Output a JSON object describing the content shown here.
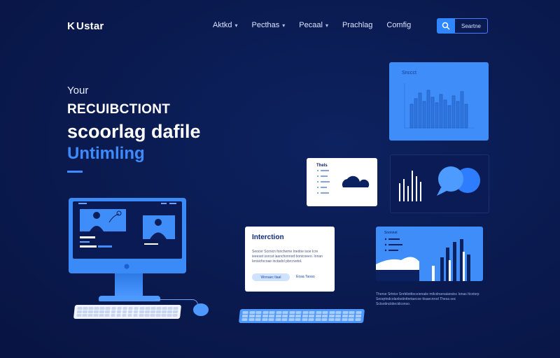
{
  "header": {
    "logo": "Ustar",
    "nav": [
      {
        "label": "Aktkd",
        "has_menu": true
      },
      {
        "label": "Pecthas",
        "has_menu": true
      },
      {
        "label": "Pecaal",
        "has_menu": true
      },
      {
        "label": "Prachlag",
        "has_menu": false
      },
      {
        "label": "Comfig",
        "has_menu": false
      }
    ],
    "search_label": "Seartne"
  },
  "hero": {
    "eyebrow": "Your",
    "line1": "RECUIBCTIONT",
    "line2": "scoorlag dafile",
    "line3": "Untimling"
  },
  "cards": {
    "chart_label": "Snccct",
    "list_title": "Thels",
    "interaction": {
      "title": "Interction",
      "body": "Seocer Scrnicn foncheme Inedoe isoe Icre ieeeset sorcut iaanchonnod bonicoeeo. Ionan Iensicfocoae inctadol pbrcrvetol.",
      "button": "Wnnaec tlaal",
      "link": "Eoaa Taoao"
    },
    "analytics_label": "Snonnet"
  },
  "caption": "Therse Srtnisr Snrbliotttoceienaiie mtlcdrsenaiansisc Ienas Itcotsrp Seoqrtndcolanbstinttnrtaecoe ttsaecnrod Thesa soc Sctsotinciidecidconso."
}
